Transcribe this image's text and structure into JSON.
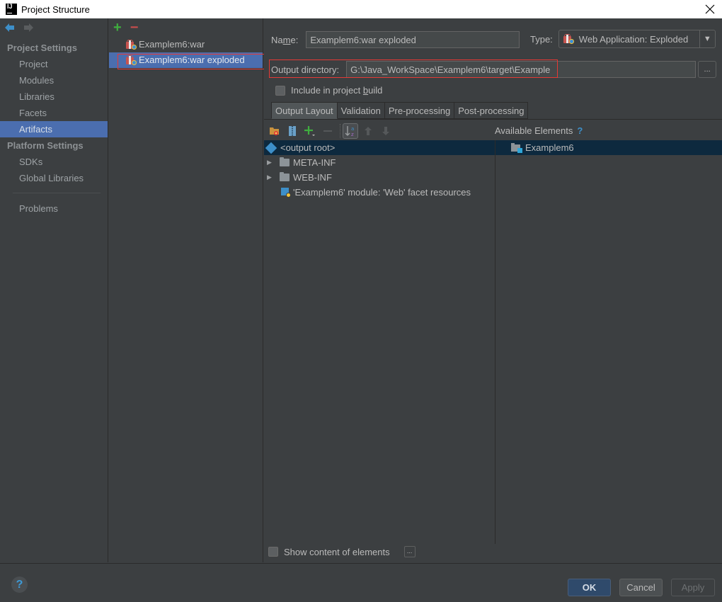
{
  "window": {
    "title": "Project Structure",
    "app_icon_text": "IJ"
  },
  "sidebar": {
    "back_icon": "back-arrow-icon",
    "forward_icon": "forward-arrow-icon",
    "project_settings_header": "Project Settings",
    "project_items": [
      {
        "label": "Project",
        "active": false
      },
      {
        "label": "Modules",
        "active": false
      },
      {
        "label": "Libraries",
        "active": false
      },
      {
        "label": "Facets",
        "active": false
      },
      {
        "label": "Artifacts",
        "active": true
      }
    ],
    "platform_settings_header": "Platform Settings",
    "platform_items": [
      {
        "label": "SDKs"
      },
      {
        "label": "Global Libraries"
      }
    ],
    "problems_label": "Problems"
  },
  "artifacts": {
    "add_symbol": "+",
    "remove_symbol": "−",
    "items": [
      {
        "label": "Examplem6:war",
        "selected": false
      },
      {
        "label": "Examplem6:war exploded",
        "selected": true
      }
    ]
  },
  "form": {
    "name_label_pre": "Na",
    "name_label_mnemonic": "m",
    "name_label_post": "e:",
    "name_value": "Examplem6:war exploded",
    "type_label": "Type:",
    "type_value": "Web Application: Exploded",
    "output_dir_label": "Output directory:",
    "output_dir_value": "G:\\Java_WorkSpace\\Examplem6\\target\\Example",
    "browse_label": "...",
    "include_build_pre": "Include in project ",
    "include_build_mnemonic": "b",
    "include_build_post": "uild",
    "include_build_checked": false
  },
  "tabs": [
    {
      "label": "Output Layout",
      "active": true
    },
    {
      "label": "Validation",
      "active": false
    },
    {
      "label": "Pre-processing",
      "active": false
    },
    {
      "label": "Post-processing",
      "active": false
    }
  ],
  "layout_toolbar": {
    "available_elements_label": "Available Elements",
    "help_symbol": "?"
  },
  "output_tree": [
    {
      "label": "<output root>",
      "type": "root",
      "selected": true
    },
    {
      "label": "META-INF",
      "type": "folder",
      "expandable": true
    },
    {
      "label": "WEB-INF",
      "type": "folder",
      "expandable": true
    },
    {
      "label": "'Examplem6' module: 'Web' facet resources",
      "type": "web-facet"
    }
  ],
  "available_elements": [
    {
      "label": "Examplem6",
      "type": "module"
    }
  ],
  "bottom": {
    "show_content_label": "Show content of elements",
    "show_content_checked": false,
    "dots_label": "..."
  },
  "footer": {
    "help_symbol": "?",
    "ok_label": "OK",
    "cancel_label": "Cancel",
    "apply_label": "Apply"
  },
  "colors": {
    "selection": "#4b6eaf",
    "tree_selection": "#0d293e",
    "highlight_outline": "#e53935",
    "accent_blue": "#3d8fc9"
  }
}
